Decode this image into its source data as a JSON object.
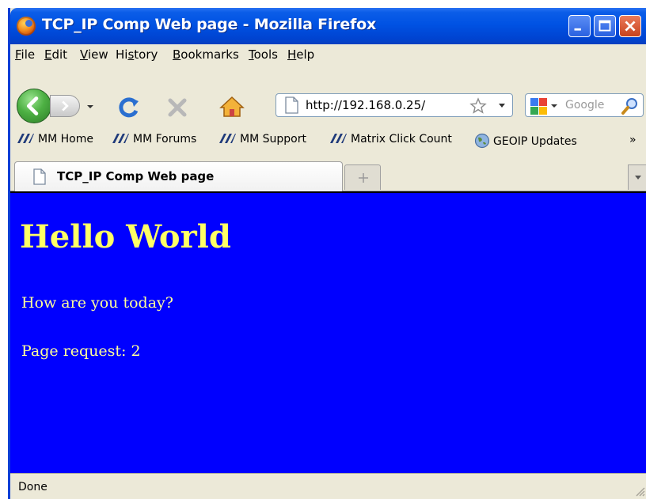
{
  "window": {
    "title": "TCP_IP Comp Web page - Mozilla Firefox"
  },
  "menu": [
    "File",
    "Edit",
    "View",
    "History",
    "Bookmarks",
    "Tools",
    "Help"
  ],
  "menu_underline": [
    "F",
    "E",
    "V",
    "s",
    "B",
    "T",
    "H"
  ],
  "nav": {
    "url": "http://192.168.0.25/",
    "search_placeholder": "Google"
  },
  "bookmarks": [
    "MM Home",
    "MM Forums",
    "MM Support",
    "Matrix Click Count",
    "GEOIP Updates"
  ],
  "bookmarks_overflow": "»",
  "tab": {
    "label": "TCP_IP Comp Web page"
  },
  "page": {
    "heading": "Hello World",
    "line1": "How are you today?",
    "line2": "Page request: 2"
  },
  "status": {
    "text": "Done"
  },
  "colors": {
    "page_background": "#0000FF",
    "heading": "#FFFF66",
    "text": "#FFFF99",
    "titlebar": "#0052E3"
  }
}
